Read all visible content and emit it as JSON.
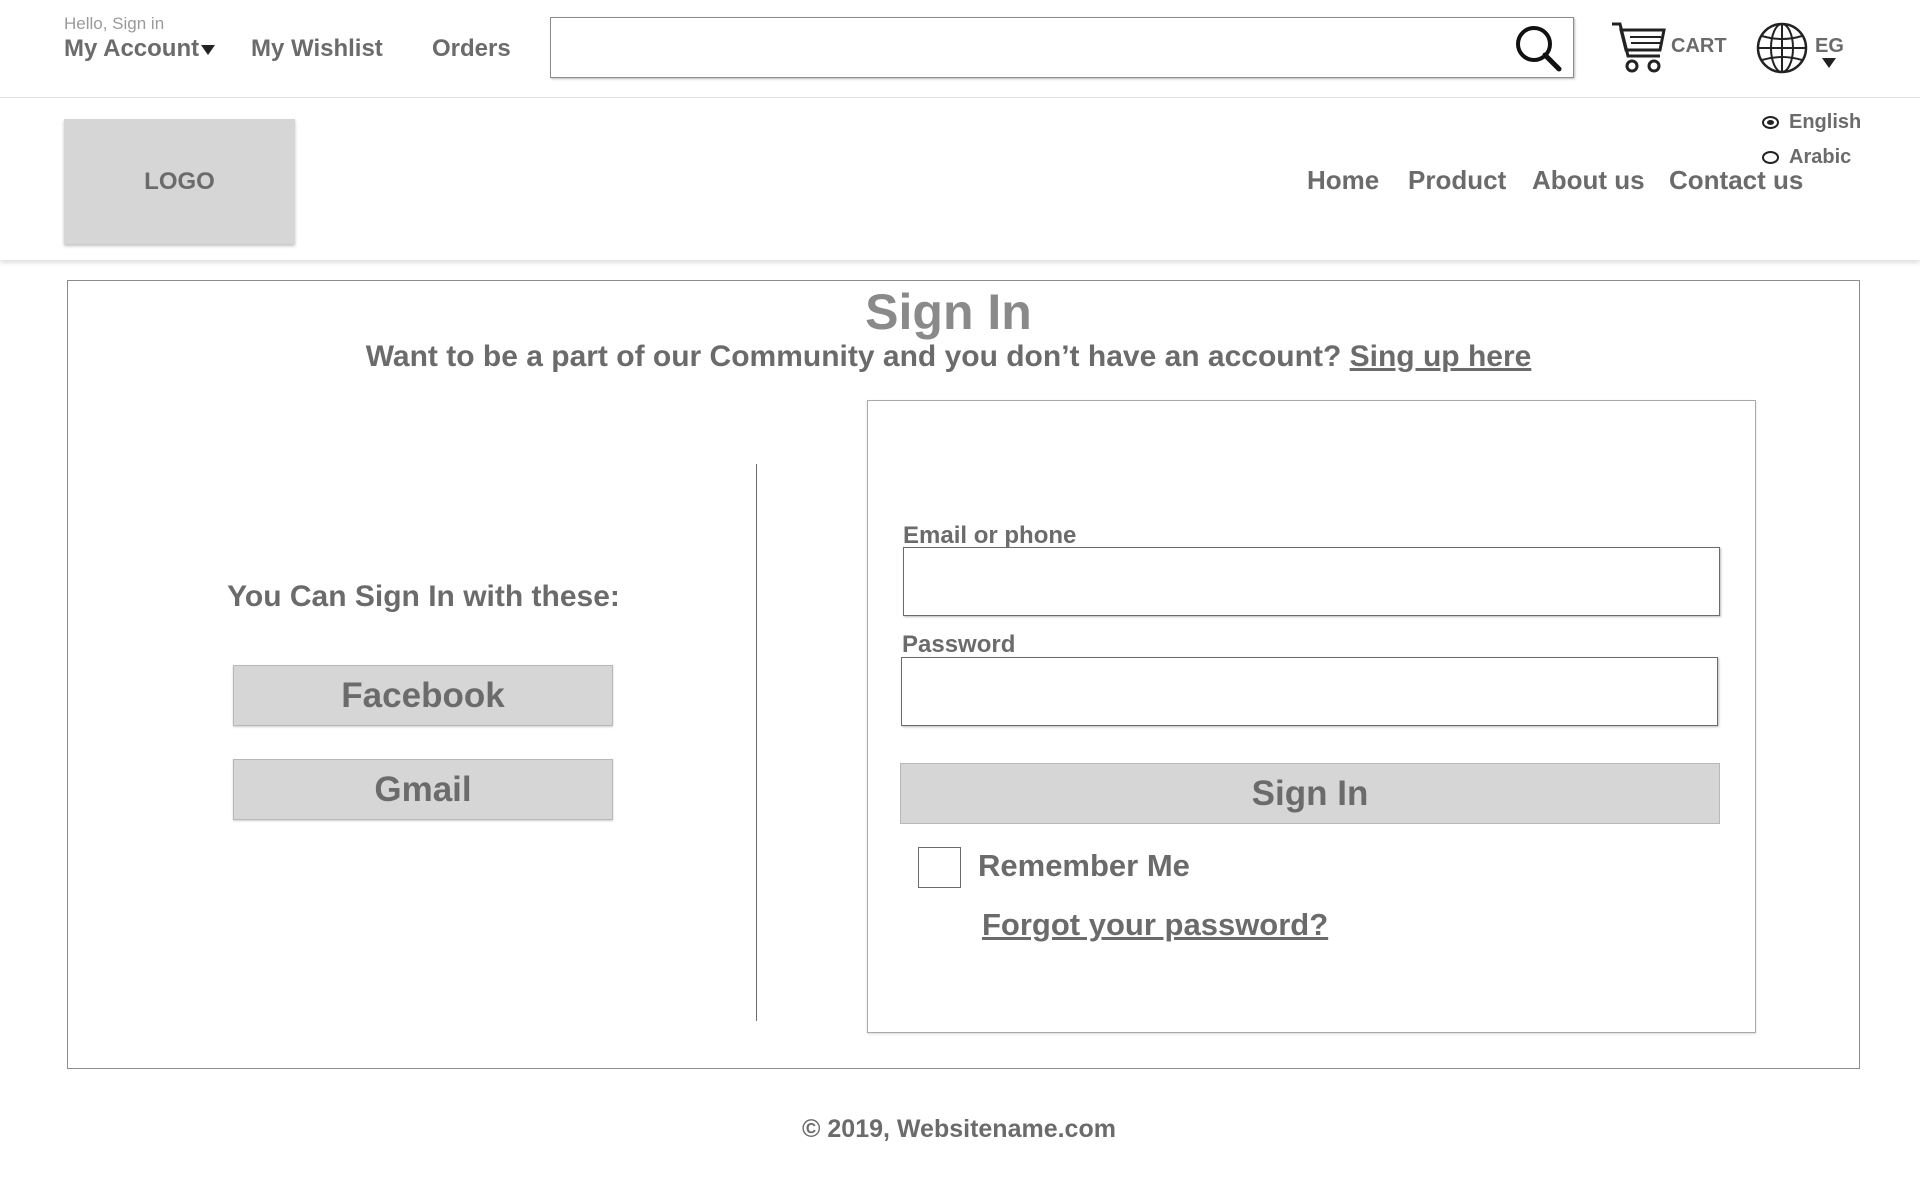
{
  "topbar": {
    "greeting": "Hello, Sign in",
    "account_label": "My Account",
    "wishlist_label": "My Wishlist",
    "orders_label": "Orders",
    "search_value": "",
    "cart_label": "CART",
    "region_label": "EG"
  },
  "header": {
    "logo_text": "LOGO",
    "languages": [
      {
        "label": "English",
        "selected": true
      },
      {
        "label": "Arabic",
        "selected": false
      }
    ],
    "nav": [
      "Home",
      "Product",
      "About us",
      "Contact us"
    ]
  },
  "signin": {
    "title": "Sign In",
    "subtitle": "Want to be a part of our Community and you don’t have an account?",
    "signup_link": "Sing up here",
    "social_label": "You Can Sign In with these:",
    "social_buttons": [
      "Facebook",
      "Gmail"
    ],
    "email_label": "Email or phone",
    "email_value": "",
    "password_label": "Password",
    "password_value": "",
    "submit_label": "Sign In",
    "remember_label": "Remember Me",
    "remember_checked": false,
    "forgot_label": "Forgot your password? "
  },
  "footer": {
    "copyright": "© 2019, Websitename.com"
  },
  "colors": {
    "text": "#6b6b6b",
    "button_bg": "#d6d6d6",
    "border": "#8c8c8c",
    "title": "#8a8a8a"
  },
  "icons": [
    "search-icon",
    "cart-icon",
    "globe-icon",
    "chevron-down-icon"
  ]
}
